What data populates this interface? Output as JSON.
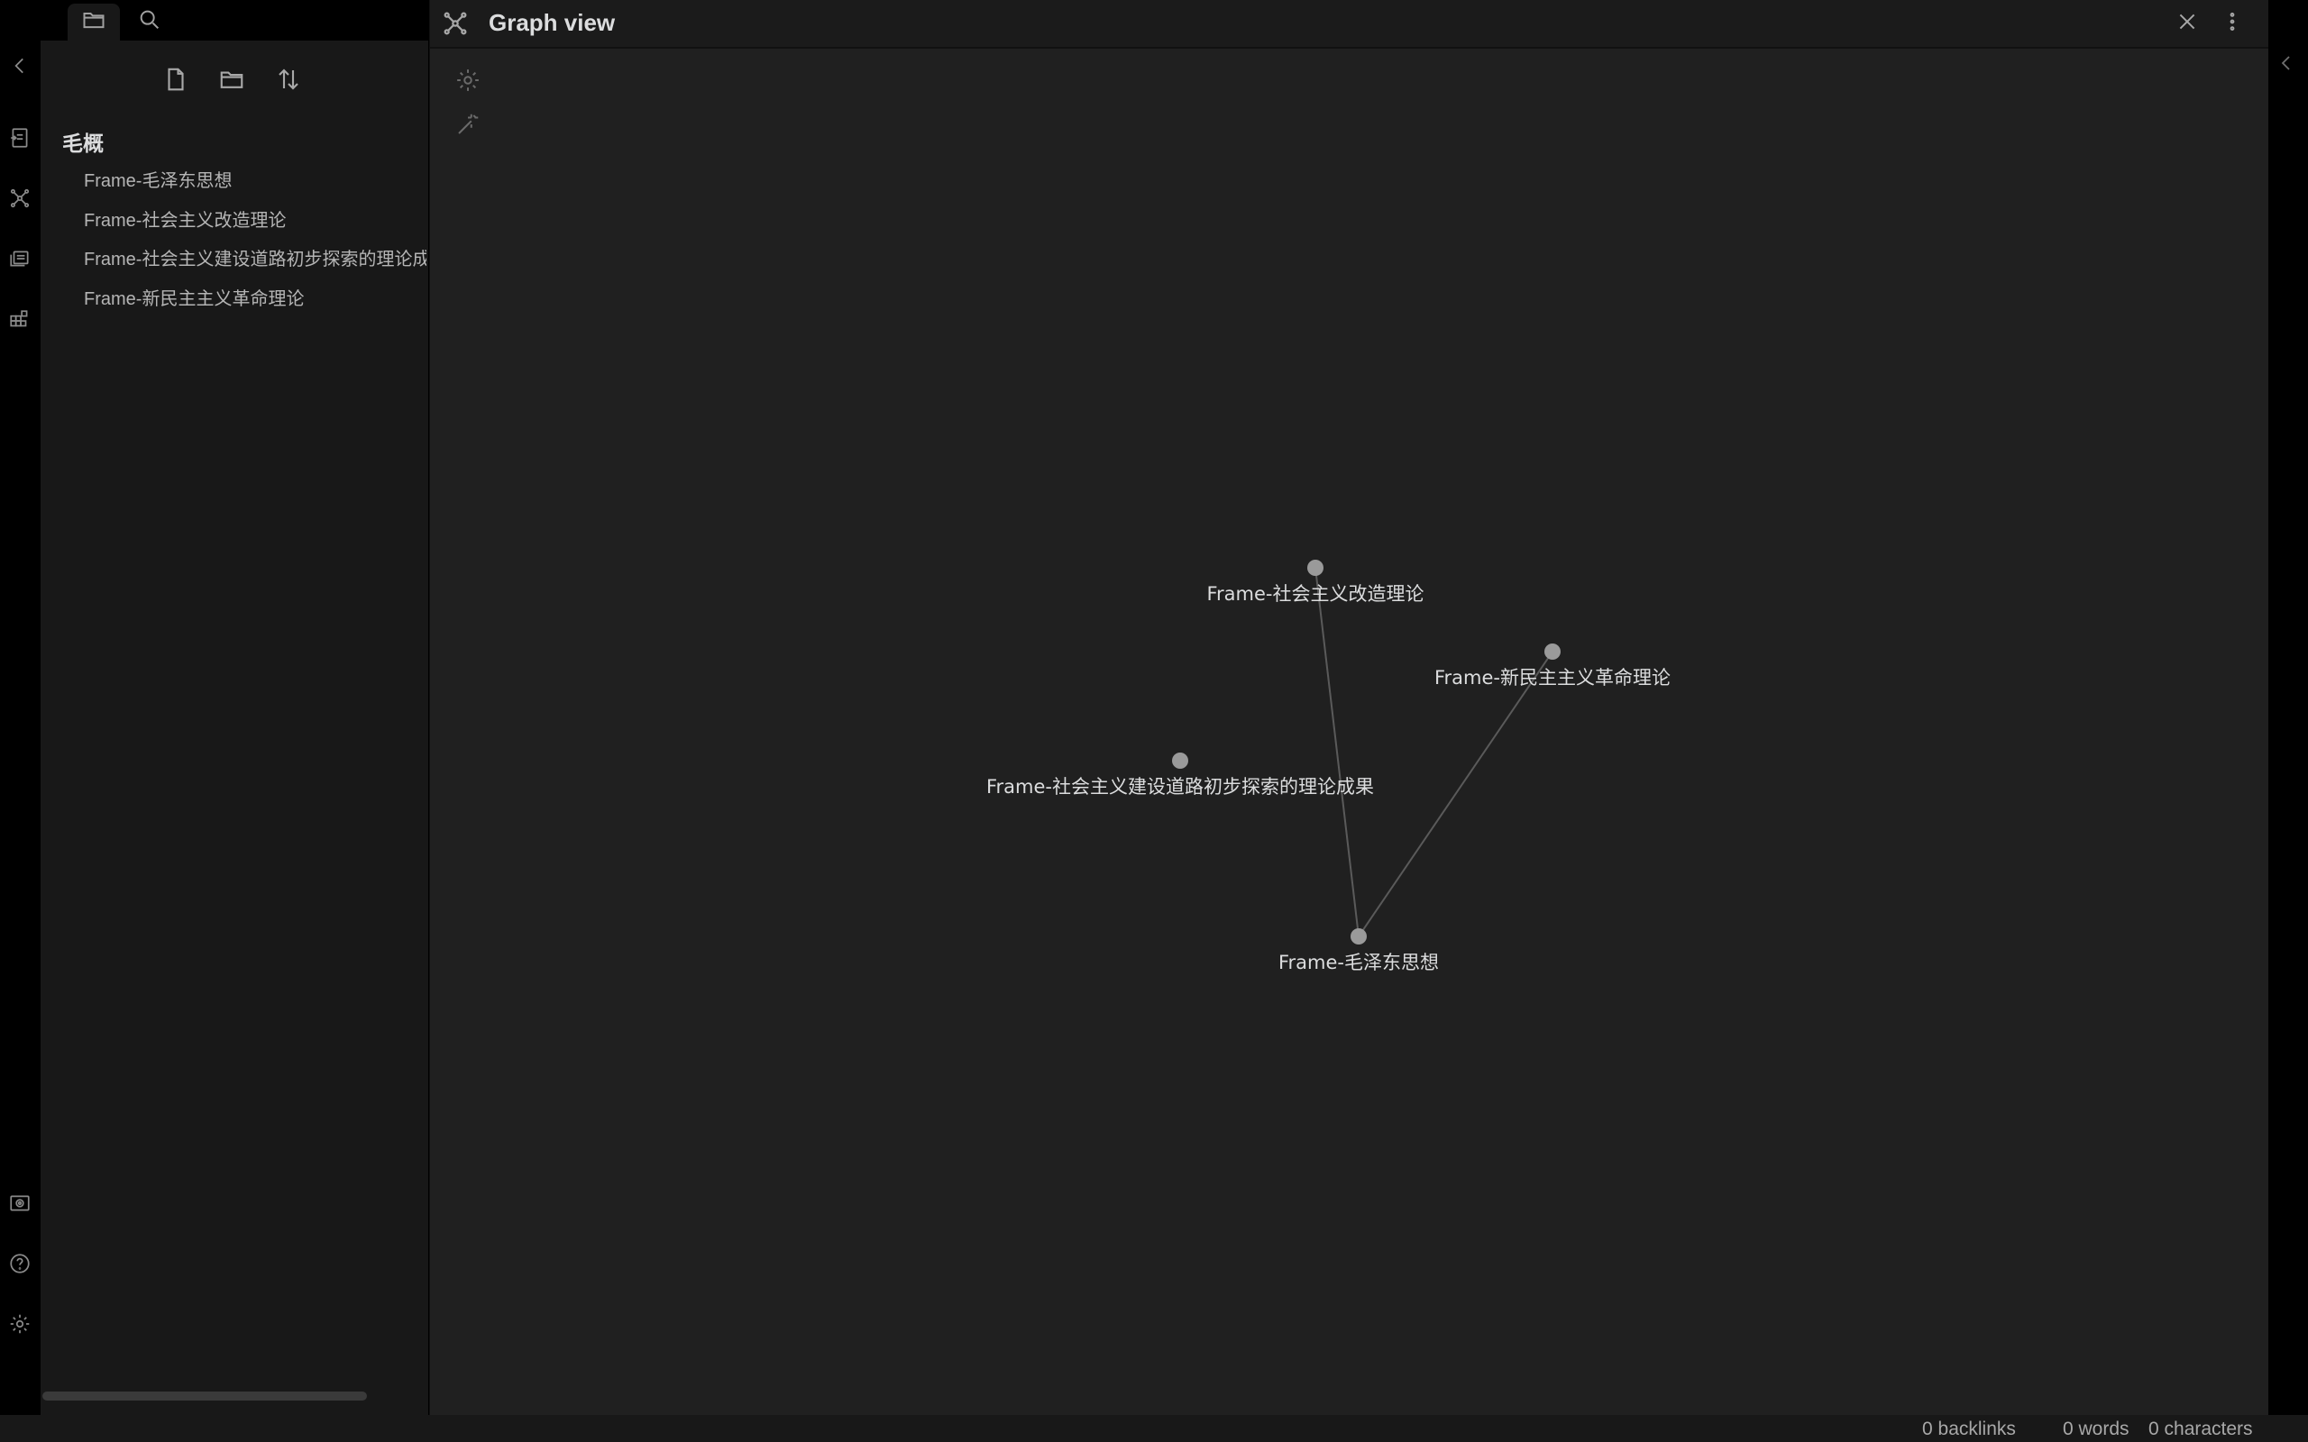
{
  "sidebar": {
    "tabs": [
      {
        "icon": "folder-icon",
        "active": true
      },
      {
        "icon": "search-icon",
        "active": false
      }
    ],
    "actions": [
      "new-note-icon",
      "new-folder-icon",
      "sort-icon"
    ],
    "folder_title": "毛概",
    "files": [
      "Frame-毛泽东思想",
      "Frame-社会主义改造理论",
      "Frame-社会主义建设道路初步探索的理论成果",
      "Frame-新民主主义革命理论"
    ]
  },
  "ribbon": {
    "icons": [
      "collapse-left-icon",
      "open-quick-switcher-icon",
      "graph-view-icon",
      "slides-icon",
      "plugins-icon",
      "vault-icon",
      "help-icon",
      "settings-icon"
    ]
  },
  "header": {
    "title": "Graph view",
    "icon": "graph-icon"
  },
  "graph": {
    "nodes": [
      {
        "id": "n1",
        "label": "Frame-社会主义改造理论"
      },
      {
        "id": "n2",
        "label": "Frame-新民主主义革命理论"
      },
      {
        "id": "n3",
        "label": "Frame-社会主义建设道路初步探索的理论成果"
      },
      {
        "id": "n4",
        "label": "Frame-毛泽东思想"
      }
    ],
    "edges": [
      {
        "from": "n4",
        "to": "n1"
      },
      {
        "from": "n4",
        "to": "n2"
      }
    ],
    "colors": {
      "node": "#9a9a9a",
      "edge": "#5a5a5a",
      "label": "#dcddde",
      "background": "#202020"
    }
  },
  "status": {
    "backlinks": "0 backlinks",
    "words": "0 words",
    "characters": "0 characters"
  }
}
